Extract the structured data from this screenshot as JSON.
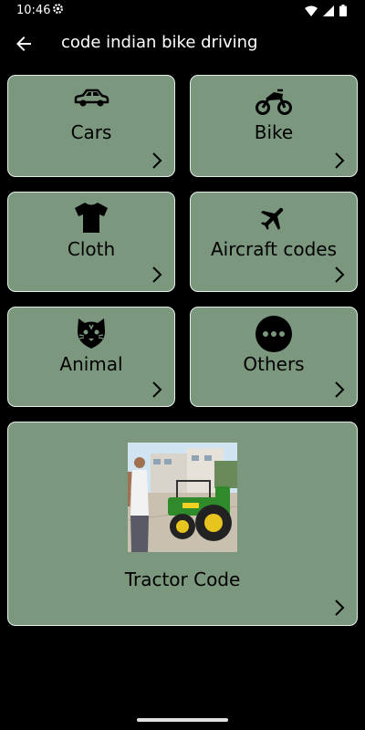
{
  "status": {
    "time": "10:46"
  },
  "app_bar": {
    "title": "code indian bike driving"
  },
  "categories": [
    {
      "label": "Cars",
      "icon": "car-icon"
    },
    {
      "label": "Bike",
      "icon": "motorcycle-icon"
    },
    {
      "label": "Cloth",
      "icon": "tshirt-icon"
    },
    {
      "label": "Aircraft codes",
      "icon": "airplane-icon"
    },
    {
      "label": "Animal",
      "icon": "tiger-icon"
    },
    {
      "label": "Others",
      "icon": "more-icon"
    }
  ],
  "featured": {
    "label": "Tractor Code",
    "image": "tractor-image"
  },
  "colors": {
    "card_bg": "#7b977e",
    "card_border": "#e6ece6",
    "background": "#000000"
  }
}
